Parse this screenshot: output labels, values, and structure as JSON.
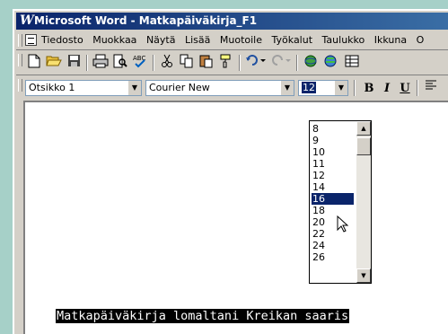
{
  "window": {
    "title": "Microsoft Word - Matkapäiväkirja_F1"
  },
  "menu": {
    "items": [
      "Tiedosto",
      "Muokkaa",
      "Näytä",
      "Lisää",
      "Muotoile",
      "Työkalut",
      "Taulukko",
      "Ikkuna",
      "O"
    ]
  },
  "toolbar": {
    "icons": [
      "new-document-icon",
      "open-folder-icon",
      "save-icon",
      "print-icon",
      "print-preview-icon",
      "spelling-icon",
      "cut-icon",
      "copy-icon",
      "paste-icon",
      "format-painter-icon",
      "undo-icon",
      "redo-icon",
      "insert-hyperlink-icon",
      "web-toolbar-icon",
      "tables-borders-icon"
    ]
  },
  "format": {
    "style_value": "Otsikko 1",
    "font_value": "Courier New",
    "size_value": "12",
    "bold_label": "B",
    "italic_label": "I",
    "underline_label": "U"
  },
  "size_dropdown": {
    "options": [
      "8",
      "9",
      "10",
      "11",
      "12",
      "14",
      "16",
      "18",
      "20",
      "22",
      "24",
      "26"
    ],
    "selected": "16"
  },
  "document": {
    "text": "Matkapäiväkirja lomaltani Kreikan saaris"
  }
}
